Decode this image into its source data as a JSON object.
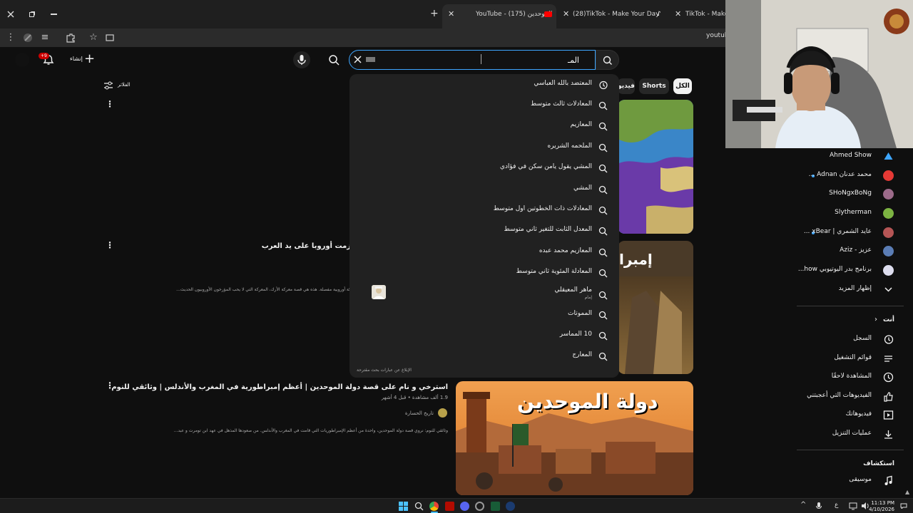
{
  "browser": {
    "tabs": [
      {
        "title": "YouTube - الموحدين (175)",
        "active": true
      },
      {
        "title": "(28)TikTok - Make Your Day",
        "active": false
      },
      {
        "title": "TikTok - Make Y",
        "active": false
      }
    ],
    "new_tab_symbol": "+",
    "address_partial": "youtul"
  },
  "header": {
    "create_label": "إنشاء",
    "notification_count": "+9",
    "search_value": "المـ",
    "search_placeholder": ""
  },
  "suggestions": [
    {
      "text": "المعتضد بالله العباسي",
      "icon": "history-icon"
    },
    {
      "text": "المعادلات ثالث متوسط",
      "icon": "search-icon"
    },
    {
      "text": "المعازيم",
      "icon": "search-icon"
    },
    {
      "text": "الملحمه الشريره",
      "icon": "search-icon"
    },
    {
      "text": "المشي يقول يامن سكن في فؤادي",
      "icon": "search-icon"
    },
    {
      "text": "المشي",
      "icon": "search-icon"
    },
    {
      "text": "المعادلات ذات الخطوتين اول متوسط",
      "icon": "search-icon"
    },
    {
      "text": "المعدل الثابت للتغير ثاني متوسط",
      "icon": "search-icon"
    },
    {
      "text": "المعازيم محمد عبده",
      "icon": "search-icon"
    },
    {
      "text": "المعادلة المئوية ثاني متوسط",
      "icon": "search-icon"
    },
    {
      "text": "ماهر المعيقلي",
      "sub": "إمام",
      "icon": "search-icon",
      "thumb": true
    },
    {
      "text": "المموتات",
      "icon": "search-icon"
    },
    {
      "text": "10 المماسر",
      "icon": "search-icon"
    },
    {
      "text": "المعارج",
      "icon": "search-icon"
    }
  ],
  "report_text": "الإبلاغ عن عبارات بحث مقترحة",
  "chips": [
    {
      "label": "الكل",
      "selected": true
    },
    {
      "label": "Shorts",
      "selected": false
    },
    {
      "label": "فيديو",
      "selected": false
    }
  ],
  "filters_label": "الفلاتر",
  "videos": [
    {
      "title": "زمت أوروبا على يد العرب",
      "description": "كة أوروبية مفصلة. هذه هي قصة معركة الأرك، المعركة التي لا يحب المؤرخون الأوروبيون الحديث..."
    },
    {
      "title": "استرخي و نام على قصة دولة الموحدين | أعظم إمبراطورية في المغرب والأندلس | وثائقي للنوم",
      "meta": "1.9 ألف مشاهدة • قبل 4 أشهر",
      "channel": "تاريخ الحسارة",
      "description": "وثائقي للنوم: نروي قصة دولة الموحدين، واحدة من أعظم الإمبراطوريات التي قامت في المغرب والأندلس. من صعودها المذهل في عهد ابن تومرت و عبد...",
      "thumb_text": "دولة الموحدين"
    }
  ],
  "thumb_partial_text": "إمبرا",
  "sidebar": {
    "subscriptions": [
      {
        "label": "Ahmed Show",
        "color": "#3ea6ff",
        "dot": false
      },
      {
        "label": "محمد عدنان Adnan ...",
        "color": "#e53935",
        "dot": true
      },
      {
        "label": "SHoNgxBoNg",
        "color": "#9c6b8a",
        "dot": false
      },
      {
        "label": "Slytherman",
        "color": "#7cb342",
        "dot": false
      },
      {
        "label": "عايد الشمري | xBear ...",
        "color": "#b55",
        "dot": true
      },
      {
        "label": "عزيز - Aziz",
        "color": "#5b7db5",
        "dot": false
      },
      {
        "label": "برنامج بدر اليوتيوبي how...",
        "color": "#dde",
        "dot": false
      }
    ],
    "show_more": "إظهار المزيد",
    "you_header": "أنت",
    "you_items": [
      {
        "label": "السجل",
        "icon": "history-icon"
      },
      {
        "label": "قوائم التشغيل",
        "icon": "playlist-icon"
      },
      {
        "label": "المشاهدة لاحقًا",
        "icon": "clock-icon"
      },
      {
        "label": "الفيديوهات التي أعجبتني",
        "icon": "thumbs-up-icon"
      },
      {
        "label": "فيديوهاتك",
        "icon": "play-square-icon"
      },
      {
        "label": "عمليات التنزيل",
        "icon": "download-icon"
      }
    ],
    "explore_header": "استكشاف",
    "explore_items": [
      {
        "label": "موسيقى",
        "icon": "music-icon"
      }
    ]
  },
  "taskbar": {
    "time": "11:13 PM",
    "date": "4/10/2026",
    "lang": "ع"
  }
}
